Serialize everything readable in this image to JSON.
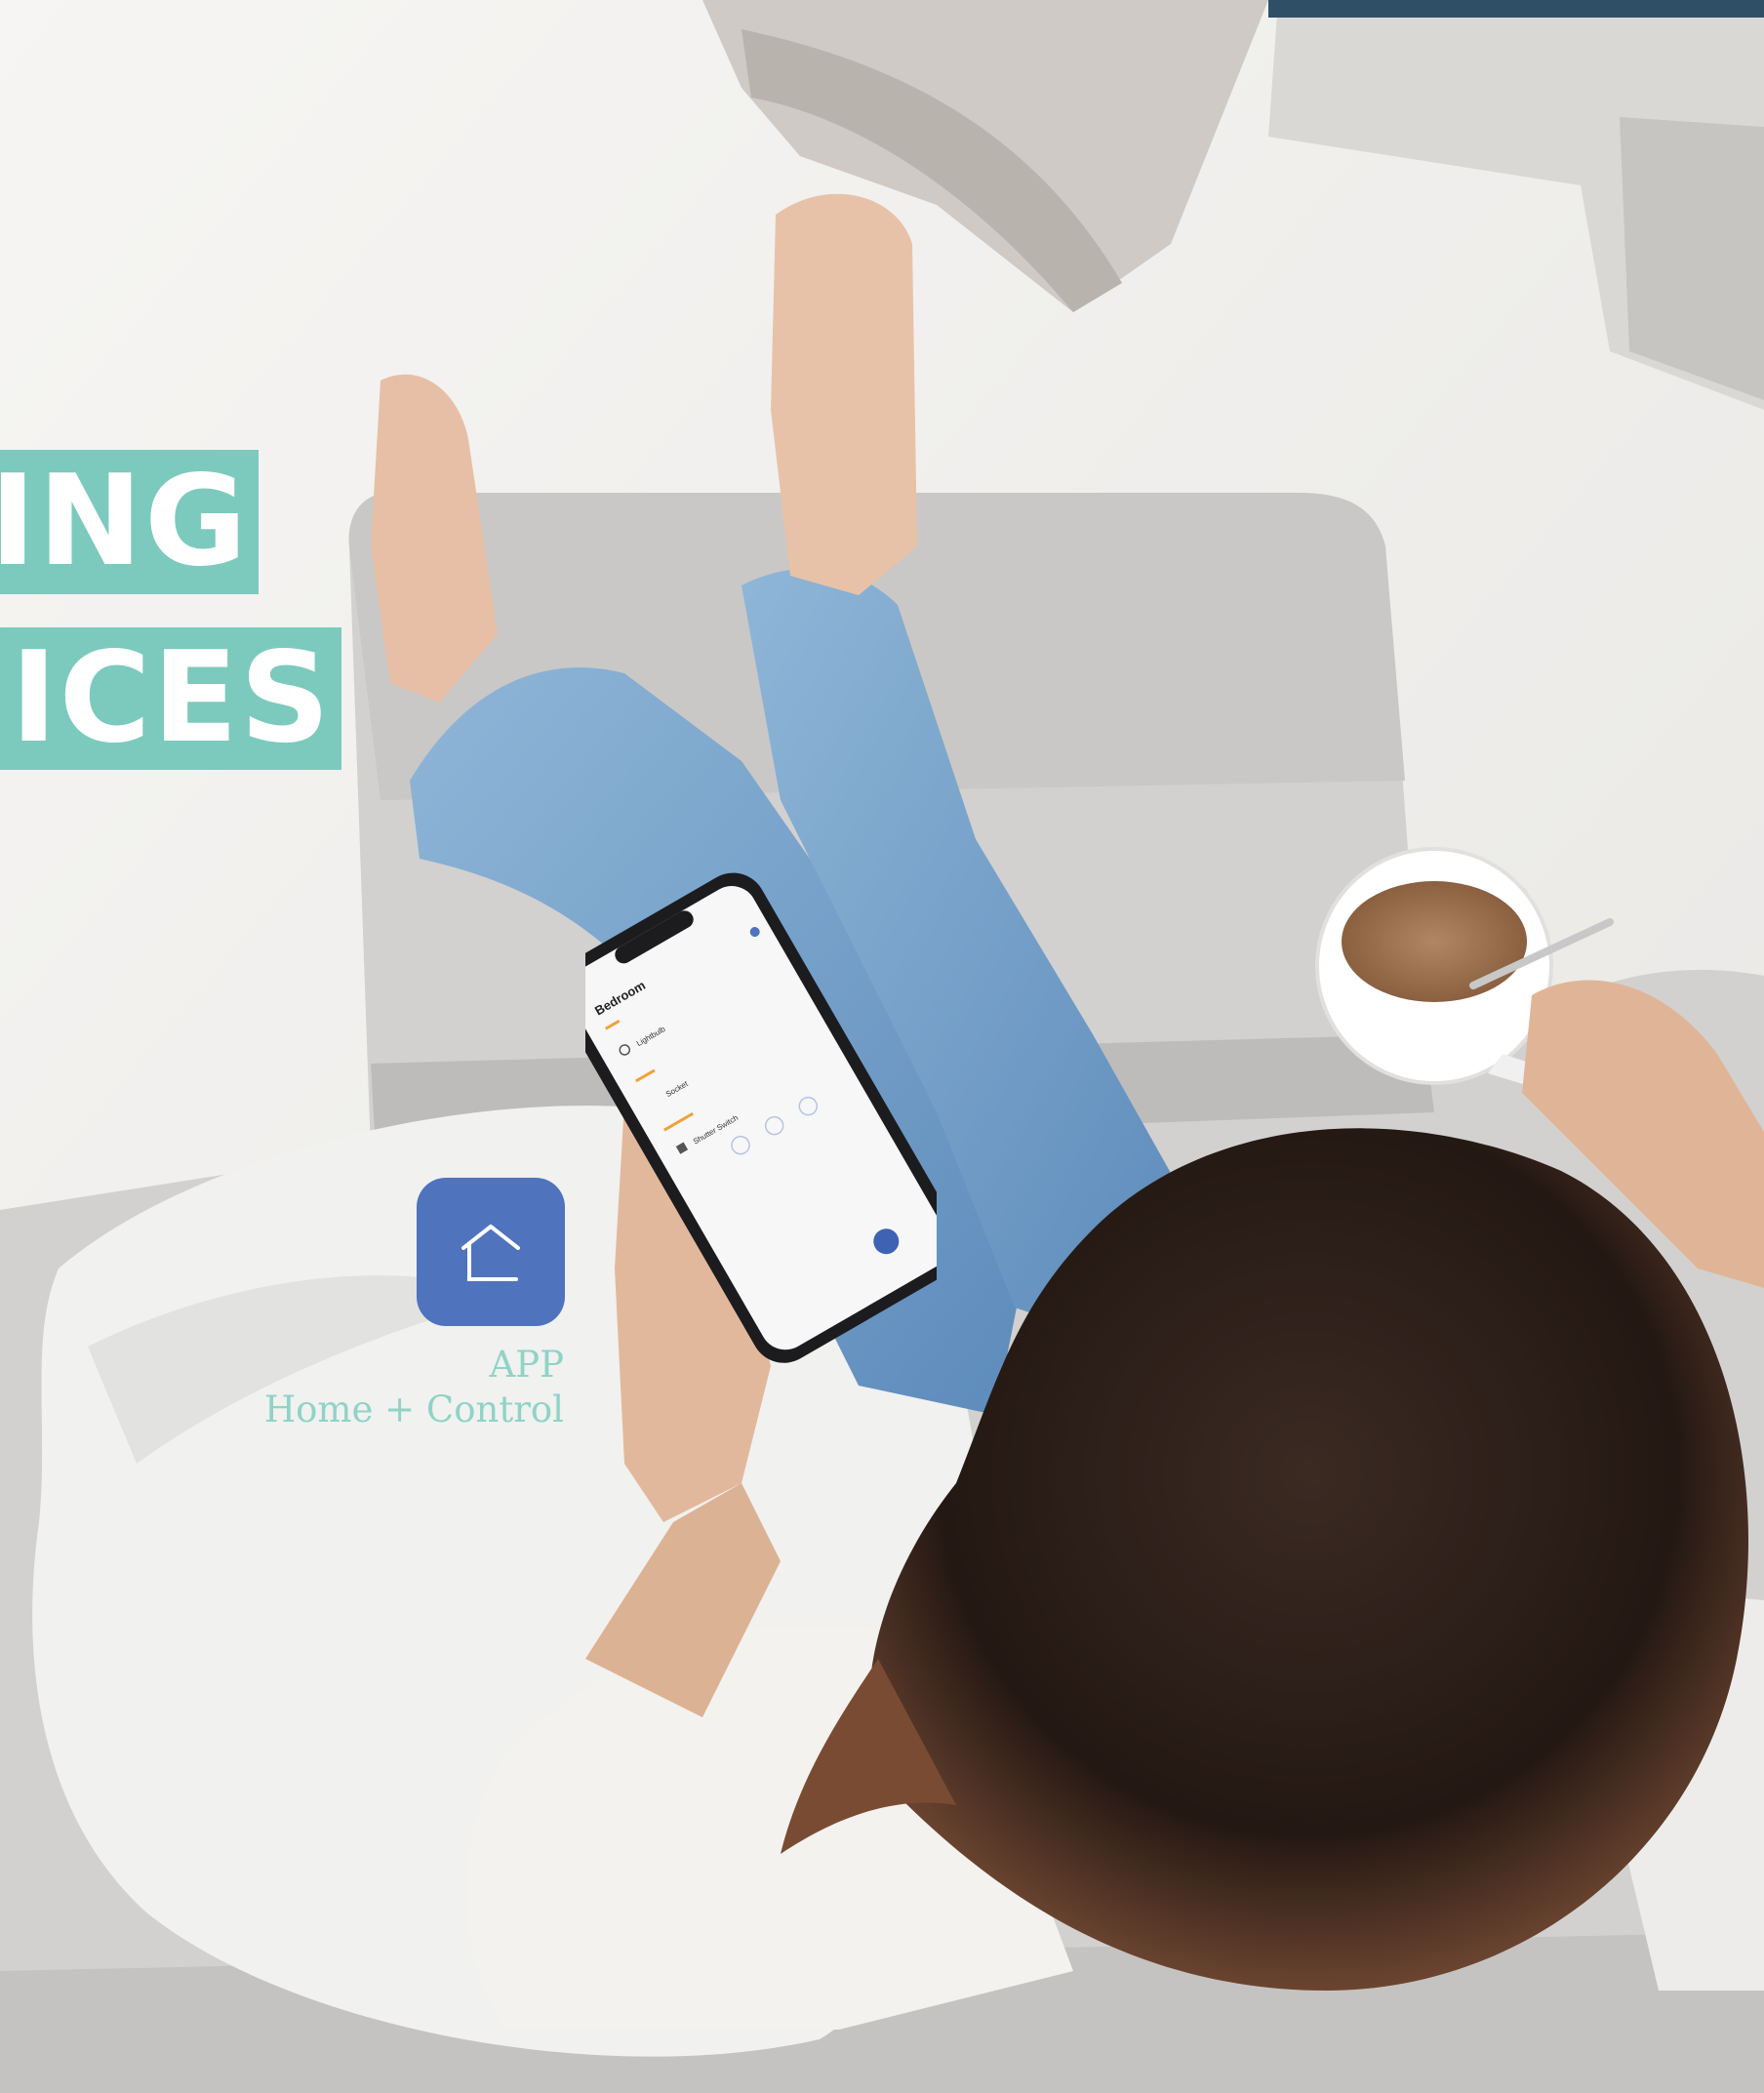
{
  "headline": {
    "line1": "ING",
    "line2": "ICES"
  },
  "app": {
    "icon": "home-outline-icon",
    "label_line1": "APP",
    "label_line2": "Home + Control"
  },
  "phone_screen": {
    "title": "Bedroom",
    "items": [
      "Lightbulb",
      "Socket",
      "Shutter Switch"
    ]
  },
  "colors": {
    "banner": "#7ccabd",
    "app_icon_bg": "#4f74bd",
    "app_label": "#8fd3c7",
    "accent_orange": "#f0a23a"
  }
}
